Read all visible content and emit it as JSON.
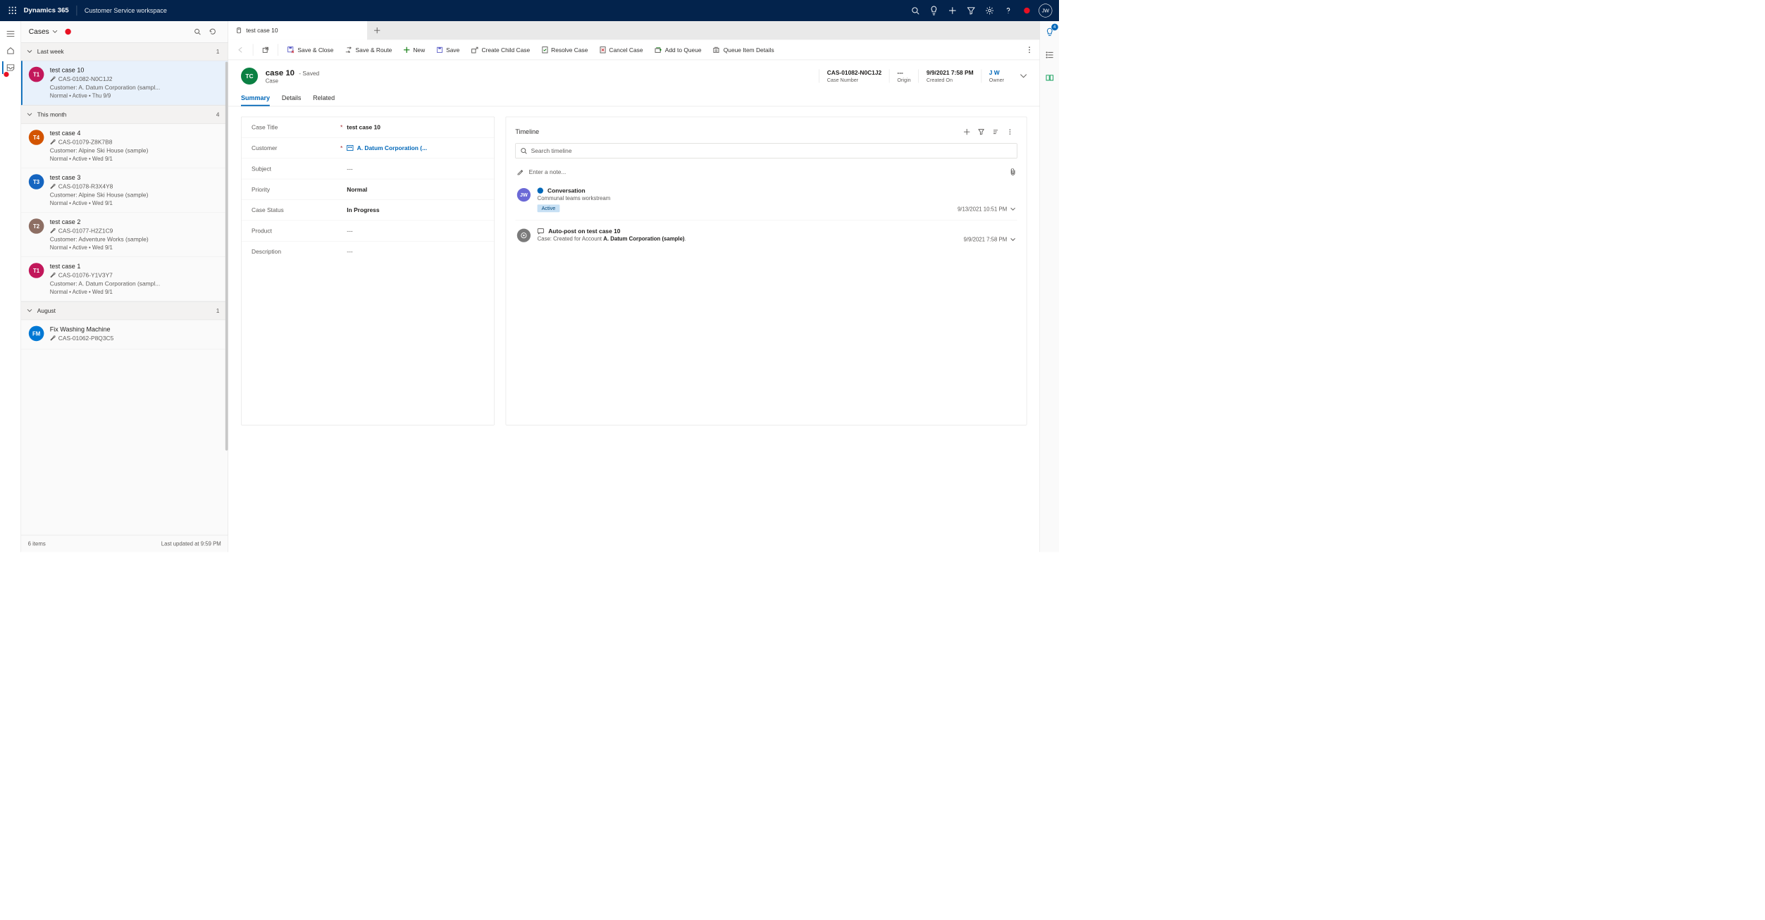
{
  "topnav": {
    "brand": "Dynamics 365",
    "workspace": "Customer Service workspace",
    "avatar": "JW",
    "notif_badge": "4"
  },
  "session": {
    "title": "Cases",
    "groups": [
      {
        "label": "Last week",
        "count": "1"
      },
      {
        "label": "This month",
        "count": "4"
      },
      {
        "label": "August",
        "count": "1"
      }
    ],
    "footer_count": "6 items",
    "footer_updated": "Last updated at 9:59 PM"
  },
  "cases": {
    "lastweek": [
      {
        "avatar": "T1",
        "color": "#c2185b",
        "title": "test case 10",
        "num": "CAS-01082-N0C1J2",
        "customer": "Customer: A. Datum Corporation (sampl...",
        "meta": "Normal  •  Active  •  Thu 9/9",
        "selected": true
      }
    ],
    "thismonth": [
      {
        "avatar": "T4",
        "color": "#d35400",
        "title": "test case 4",
        "num": "CAS-01079-Z8K7B8",
        "customer": "Customer: Alpine Ski House (sample)",
        "meta": "Normal  •  Active  •  Wed 9/1"
      },
      {
        "avatar": "T3",
        "color": "#1565c0",
        "title": "test case 3",
        "num": "CAS-01078-R3X4Y8",
        "customer": "Customer: Alpine Ski House (sample)",
        "meta": "Normal  •  Active  •  Wed 9/1"
      },
      {
        "avatar": "T2",
        "color": "#8d6e63",
        "title": "test case 2",
        "num": "CAS-01077-H2Z1C9",
        "customer": "Customer: Adventure Works (sample)",
        "meta": "Normal  •  Active  •  Wed 9/1"
      },
      {
        "avatar": "T1",
        "color": "#c2185b",
        "title": "test case 1",
        "num": "CAS-01076-Y1V3Y7",
        "customer": "Customer: A. Datum Corporation (sampl...",
        "meta": "Normal  •  Active  •  Wed 9/1"
      }
    ],
    "august": [
      {
        "avatar": "FM",
        "color": "#0078d4",
        "title": "Fix Washing Machine",
        "num": "CAS-01062-P8Q3C5"
      }
    ]
  },
  "tab": {
    "label": "test case 10"
  },
  "cmdbar": {
    "save_close": "Save & Close",
    "save_route": "Save & Route",
    "new": "New",
    "save": "Save",
    "create_child": "Create Child Case",
    "resolve": "Resolve Case",
    "cancel": "Cancel Case",
    "add_queue": "Add to Queue",
    "queue_details": "Queue Item Details"
  },
  "record": {
    "avatar": "TC",
    "title": "case 10",
    "saved": "- Saved",
    "entity": "Case",
    "case_number_v": "CAS-01082-N0C1J2",
    "case_number_l": "Case Number",
    "origin_v": "---",
    "origin_l": "Origin",
    "created_v": "9/9/2021 7:58 PM",
    "created_l": "Created On",
    "owner_v": "J W",
    "owner_l": "Owner"
  },
  "tabs2": {
    "summary": "Summary",
    "details": "Details",
    "related": "Related"
  },
  "fields": {
    "case_title_l": "Case Title",
    "case_title_v": "test case 10",
    "customer_l": "Customer",
    "customer_v": "A. Datum Corporation (...",
    "subject_l": "Subject",
    "subject_v": "---",
    "priority_l": "Priority",
    "priority_v": "Normal",
    "status_l": "Case Status",
    "status_v": "In Progress",
    "product_l": "Product",
    "product_v": "---",
    "desc_l": "Description",
    "desc_v": "---"
  },
  "timeline": {
    "title": "Timeline",
    "search_ph": "Search timeline",
    "note_ph": "Enter a note...",
    "items": [
      {
        "avatar": "JW",
        "avcolor": "#6b69d6",
        "kind": "Conversation",
        "sub": "Communal teams workstream",
        "badge": "Active",
        "time": "9/13/2021 10:51 PM"
      },
      {
        "avatar": "⊕",
        "avcolor": "#7a7a7a",
        "kind": "Auto-post on test case 10",
        "sub_prefix": "Case: Created for Account ",
        "sub_bold": "A. Datum Corporation (sample)",
        "sub_suffix": ".",
        "time": "9/9/2021 7:58 PM"
      }
    ]
  }
}
